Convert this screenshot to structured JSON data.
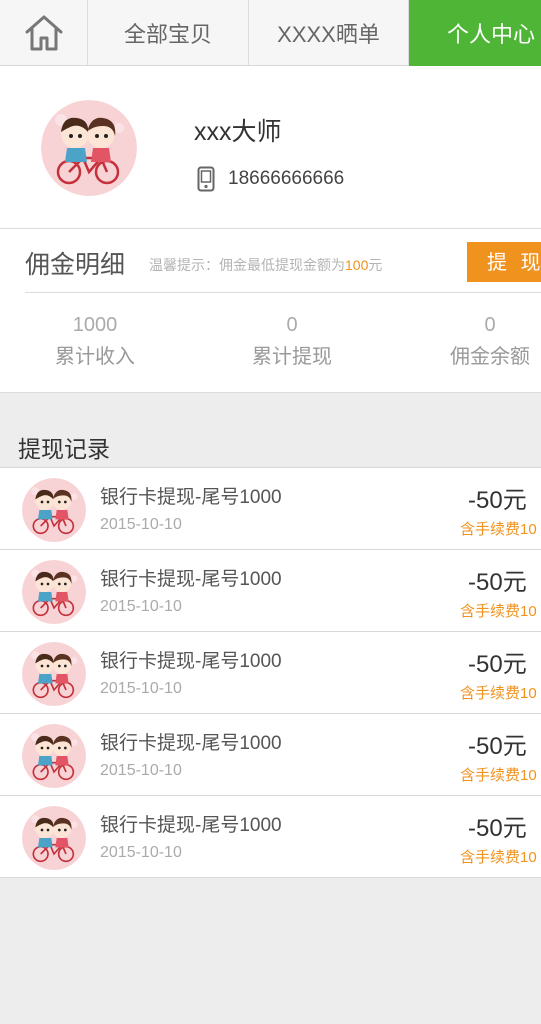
{
  "nav": {
    "home_icon": "home-icon",
    "tabs": [
      {
        "label": "全部宝贝"
      },
      {
        "label": "XXXX晒单"
      },
      {
        "label": "个人中心",
        "active": true
      }
    ],
    "active_color": "#4eb536"
  },
  "profile": {
    "name": "xxx大师",
    "phone": "18666666666",
    "avatar_icon": "avatar-cartoon-couple-bicycle",
    "phone_icon": "mobile-phone-icon"
  },
  "commission": {
    "title": "佣金明细",
    "tip_prefix": "温馨提示：佣金最低提现金额为",
    "tip_amount": "100",
    "tip_suffix": "元",
    "withdraw_label": "提 现",
    "accent": "#f0921e",
    "stats": [
      {
        "value": "1000",
        "label": "累计收入"
      },
      {
        "value": "0",
        "label": "累计提现"
      },
      {
        "value": "0",
        "label": "佣金余额"
      }
    ]
  },
  "records": {
    "title": "提现记录",
    "items": [
      {
        "title": "银行卡提现-尾号1000",
        "date": "2015-10-10",
        "amount": "-50元",
        "fee": "含手续费10"
      },
      {
        "title": "银行卡提现-尾号1000",
        "date": "2015-10-10",
        "amount": "-50元",
        "fee": "含手续费10"
      },
      {
        "title": "银行卡提现-尾号1000",
        "date": "2015-10-10",
        "amount": "-50元",
        "fee": "含手续费10"
      },
      {
        "title": "银行卡提现-尾号1000",
        "date": "2015-10-10",
        "amount": "-50元",
        "fee": "含手续费10"
      },
      {
        "title": "银行卡提现-尾号1000",
        "date": "2015-10-10",
        "amount": "-50元",
        "fee": "含手续费10"
      }
    ]
  }
}
